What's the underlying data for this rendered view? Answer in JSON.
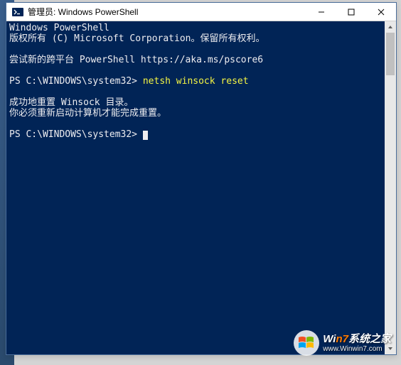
{
  "window": {
    "title": "管理员: Windows PowerShell"
  },
  "terminal": {
    "line1": "Windows PowerShell",
    "line2": "版权所有 (C) Microsoft Corporation。保留所有权利。",
    "line3": "尝试新的跨平台 PowerShell https://aka.ms/pscore6",
    "prompt1_prefix": "PS C:\\WINDOWS\\system32> ",
    "prompt1_cmd": "netsh winsock reset",
    "line4": "成功地重置 Winsock 目录。",
    "line5": "你必须重新启动计算机才能完成重置。",
    "prompt2": "PS C:\\WINDOWS\\system32> "
  },
  "watermark": {
    "brand_prefix": "Wi",
    "brand_accent": "n7",
    "brand_suffix": "系统之家",
    "url": "www.Winwin7.com"
  }
}
